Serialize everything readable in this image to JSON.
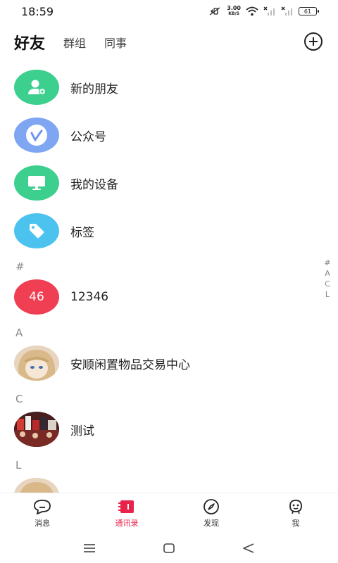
{
  "status_bar": {
    "time": "18:59",
    "net_speed_value": "3.00",
    "net_speed_unit": "KB/S",
    "battery": "61"
  },
  "header": {
    "tabs": [
      {
        "label": "好友"
      },
      {
        "label": "群组"
      },
      {
        "label": "同事"
      }
    ],
    "add_icon": "plus-circle-icon"
  },
  "functions": [
    {
      "label": "新的朋友",
      "icon": "add-user-icon",
      "color": "#3ccf8e"
    },
    {
      "label": "公众号",
      "icon": "official-account-icon",
      "color": "#7ea6f2"
    },
    {
      "label": "我的设备",
      "icon": "monitor-icon",
      "color": "#3ccf8e"
    },
    {
      "label": "标签",
      "icon": "tag-icon",
      "color": "#4cc3ef"
    }
  ],
  "sections": [
    {
      "letter": "#",
      "contacts": [
        {
          "name": "12346",
          "badge": "46",
          "color": "#f03e52"
        }
      ]
    },
    {
      "letter": "A",
      "contacts": [
        {
          "name": "安顺闲置物品交易中心"
        }
      ]
    },
    {
      "letter": "C",
      "contacts": [
        {
          "name": "测试"
        }
      ]
    },
    {
      "letter": "L",
      "contacts": [
        {
          "name": ""
        }
      ]
    }
  ],
  "index_bar": [
    "#",
    "A",
    "C",
    "L"
  ],
  "bottom_nav": [
    {
      "label": "消息",
      "icon": "chat-icon"
    },
    {
      "label": "通讯录",
      "icon": "contacts-icon"
    },
    {
      "label": "发现",
      "icon": "compass-icon"
    },
    {
      "label": "我",
      "icon": "profile-icon"
    }
  ],
  "colors": {
    "accent": "#e8234a",
    "green": "#3ccf8e",
    "blue": "#7ea6f2",
    "cyan": "#4cc3ef"
  }
}
